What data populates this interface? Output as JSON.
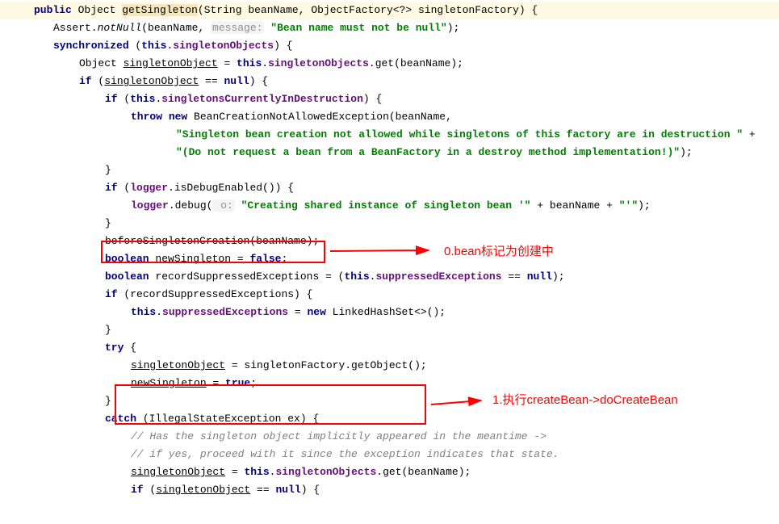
{
  "sig": {
    "public": "public",
    "returnType": "Object",
    "name": "getSingleton",
    "p1t": "String",
    "p1n": "beanName",
    "p2t": "ObjectFactory<?>",
    "p2n": "singletonFactory"
  },
  "l2": {
    "assert": "Assert.",
    "notNull": "notNull",
    "arg1": "(beanName, ",
    "hint": "message:",
    "str": "\"Bean name must not be null\"",
    "end": ");"
  },
  "l3": {
    "sync": "synchronized",
    "open": " (",
    "this": "this",
    "dot": ".",
    "field": "singletonObjects",
    "close": ") {"
  },
  "l4": {
    "pre": "Object ",
    "var": "singletonObject",
    "eq": " = ",
    "this": "this",
    "dot": ".",
    "field": "singletonObjects",
    "call": ".get(beanName);"
  },
  "l5": {
    "if": "if",
    "open": " (",
    "var": "singletonObject",
    "eq": " == ",
    "nul": "null",
    "close": ") {"
  },
  "l6": {
    "if": "if",
    "open": " (",
    "this": "this",
    "dot": ".",
    "field": "singletonsCurrentlyInDestruction",
    "close": ") {"
  },
  "l7": {
    "throw": "throw",
    "new": "new",
    "cls": " BeanCreationNotAllowedException(beanName,"
  },
  "l8": {
    "str": "\"Singleton bean creation not allowed while singletons of this factory are in destruction \"",
    "plus": " +"
  },
  "l9": {
    "str": "\"(Do not request a bean from a BeanFactory in a destroy method implementation!)\"",
    "end": ");"
  },
  "l10": {
    "brace": "}"
  },
  "l11": {
    "if": "if",
    "open": " (",
    "logger": "logger",
    "call": ".isDebugEnabled()) {"
  },
  "l12": {
    "logger": "logger",
    "debug": ".debug(",
    "hint": " o:",
    "str1": " \"Creating shared instance of singleton bean '\"",
    "mid": " + beanName + ",
    "str2": "\"'\"",
    "end": ");"
  },
  "l13": {
    "brace": "}"
  },
  "l14": {
    "text": "beforeSingletonCreation(beanName);"
  },
  "l15": {
    "bool": "boolean",
    "var": "newSingleton",
    "eq": " = ",
    "false": "false",
    "semi": ";"
  },
  "l16": {
    "bool": "boolean",
    "var": " recordSuppressedExceptions = (",
    "this": "this",
    "dot": ".",
    "field": "suppressedExceptions",
    "eq": " == ",
    "nul": "null",
    "end": ");"
  },
  "l17": {
    "if": "if",
    "text": " (recordSuppressedExceptions) {"
  },
  "l18": {
    "this": "this",
    "dot": ".",
    "field": "suppressedExceptions",
    "eq": " = ",
    "new": "new",
    "rest": " LinkedHashSet<>();"
  },
  "l19": {
    "brace": "}"
  },
  "l20": {
    "try": "try",
    "brace": " {"
  },
  "l21": {
    "var": "singletonObject",
    "rest": " = singletonFactory.getObject();"
  },
  "l22": {
    "var": "newSingleton",
    "eq": " = ",
    "true": "true",
    "semi": ";"
  },
  "l23": {
    "brace": "}"
  },
  "l24": {
    "catch": "catch",
    "text": " (IllegalStateException ex) {"
  },
  "l25": {
    "comment": "// Has the singleton object implicitly appeared in the meantime ->"
  },
  "l26": {
    "comment": "// if yes, proceed with it since the exception indicates that state."
  },
  "l27": {
    "var": "singletonObject",
    "eq": " = ",
    "this": "this",
    "dot": ".",
    "field": "singletonObjects",
    "call": ".get(beanName);"
  },
  "l28": {
    "if": "if",
    "open": " (",
    "var": "singletonObject",
    "eq": " == ",
    "nul": "null",
    "close": ") {"
  },
  "annotations": {
    "a1": "0.bean标记为创建中",
    "a2": "1.执行createBean->doCreateBean"
  }
}
